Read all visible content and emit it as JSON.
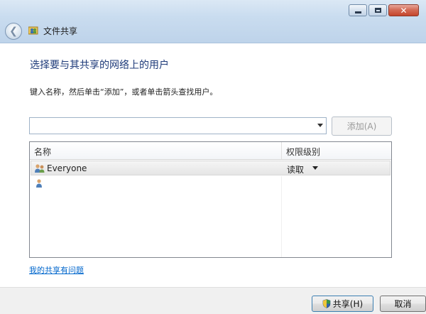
{
  "window": {
    "title": "文件共享"
  },
  "page": {
    "heading": "选择要与其共享的网络上的用户",
    "instruction": "键入名称，然后单击“添加”，或者单击箭头查找用户。"
  },
  "user_input": {
    "value": "",
    "add_button_label": "添加(A)"
  },
  "listview": {
    "columns": [
      "名称",
      "权限级别"
    ],
    "rows": [
      {
        "name": "Everyone",
        "permission": "读取"
      }
    ]
  },
  "help_link": "我的共享有问题",
  "buttons": {
    "share": "共享(H)",
    "cancel": "取消"
  },
  "colors": {
    "heading": "#1f3b7a",
    "link": "#0066cc",
    "title_bar": "#c9dcef"
  }
}
